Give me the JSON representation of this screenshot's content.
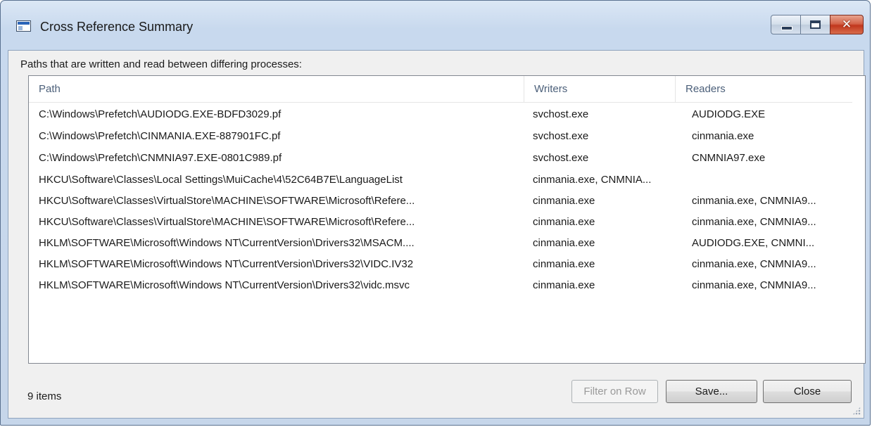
{
  "window": {
    "title": "Cross Reference Summary"
  },
  "caption_buttons": {
    "close_glyph": "✕"
  },
  "description": "Paths that are written and read between differing processes:",
  "table": {
    "columns": [
      "Path",
      "Writers",
      "Readers"
    ],
    "rows": [
      {
        "path": "C:\\Windows\\Prefetch\\AUDIODG.EXE-BDFD3029.pf",
        "writers": "svchost.exe",
        "readers": "AUDIODG.EXE"
      },
      {
        "path": "C:\\Windows\\Prefetch\\CINMANIA.EXE-887901FC.pf",
        "writers": "svchost.exe",
        "readers": "cinmania.exe"
      },
      {
        "path": "C:\\Windows\\Prefetch\\CNMNIA97.EXE-0801C989.pf",
        "writers": "svchost.exe",
        "readers": "CNMNIA97.exe"
      },
      {
        "path": "HKCU\\Software\\Classes\\Local Settings\\MuiCache\\4\\52C64B7E\\LanguageList",
        "writers": "cinmania.exe, CNMNIA...",
        "readers": ""
      },
      {
        "path": "HKCU\\Software\\Classes\\VirtualStore\\MACHINE\\SOFTWARE\\Microsoft\\Refere...",
        "writers": "cinmania.exe",
        "readers": "cinmania.exe, CNMNIA9..."
      },
      {
        "path": "HKCU\\Software\\Classes\\VirtualStore\\MACHINE\\SOFTWARE\\Microsoft\\Refere...",
        "writers": "cinmania.exe",
        "readers": "cinmania.exe, CNMNIA9..."
      },
      {
        "path": "HKLM\\SOFTWARE\\Microsoft\\Windows NT\\CurrentVersion\\Drivers32\\MSACM....",
        "writers": "cinmania.exe",
        "readers": "AUDIODG.EXE, CNMNI..."
      },
      {
        "path": "HKLM\\SOFTWARE\\Microsoft\\Windows NT\\CurrentVersion\\Drivers32\\VIDC.IV32",
        "writers": "cinmania.exe",
        "readers": "cinmania.exe, CNMNIA9..."
      },
      {
        "path": "HKLM\\SOFTWARE\\Microsoft\\Windows NT\\CurrentVersion\\Drivers32\\vidc.msvc",
        "writers": "cinmania.exe",
        "readers": "cinmania.exe, CNMNIA9..."
      }
    ]
  },
  "status": {
    "count_label": "9 items"
  },
  "buttons": {
    "filter_label": "Filter on Row",
    "filter_enabled": false,
    "save_label": "Save...",
    "close_label": "Close"
  }
}
